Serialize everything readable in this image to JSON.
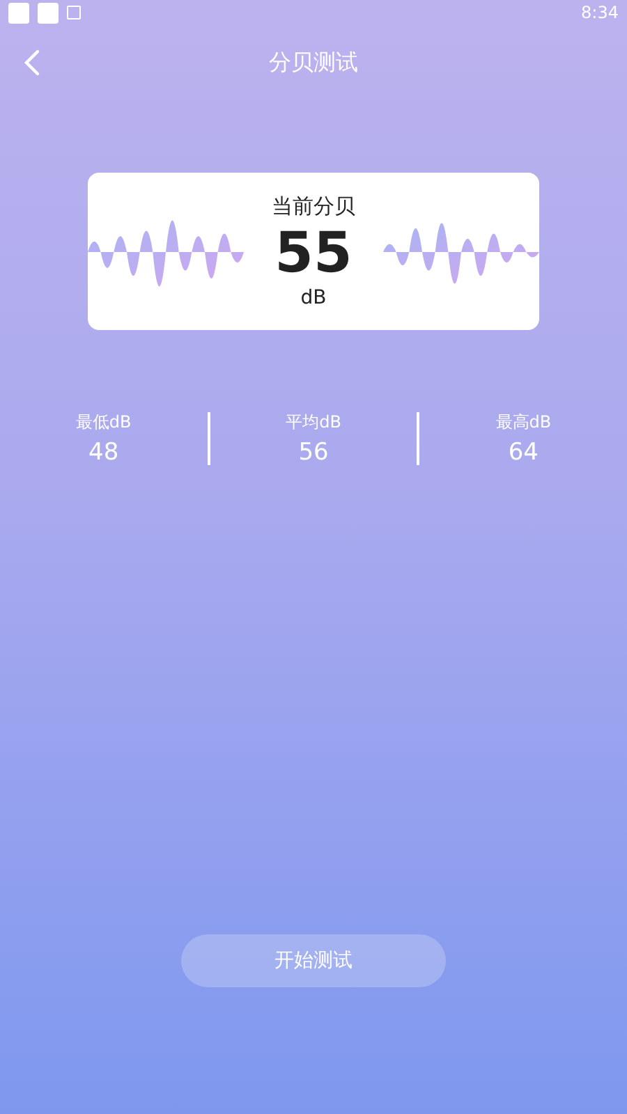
{
  "status_bar": {
    "time": "8:34"
  },
  "header": {
    "title": "分贝测试"
  },
  "meter": {
    "label": "当前分贝",
    "value": "55",
    "unit": "dB"
  },
  "stats": [
    {
      "label": "最低dB",
      "value": "48"
    },
    {
      "label": "平均dB",
      "value": "56"
    },
    {
      "label": "最高dB",
      "value": "64"
    }
  ],
  "start_button": "开始测试"
}
